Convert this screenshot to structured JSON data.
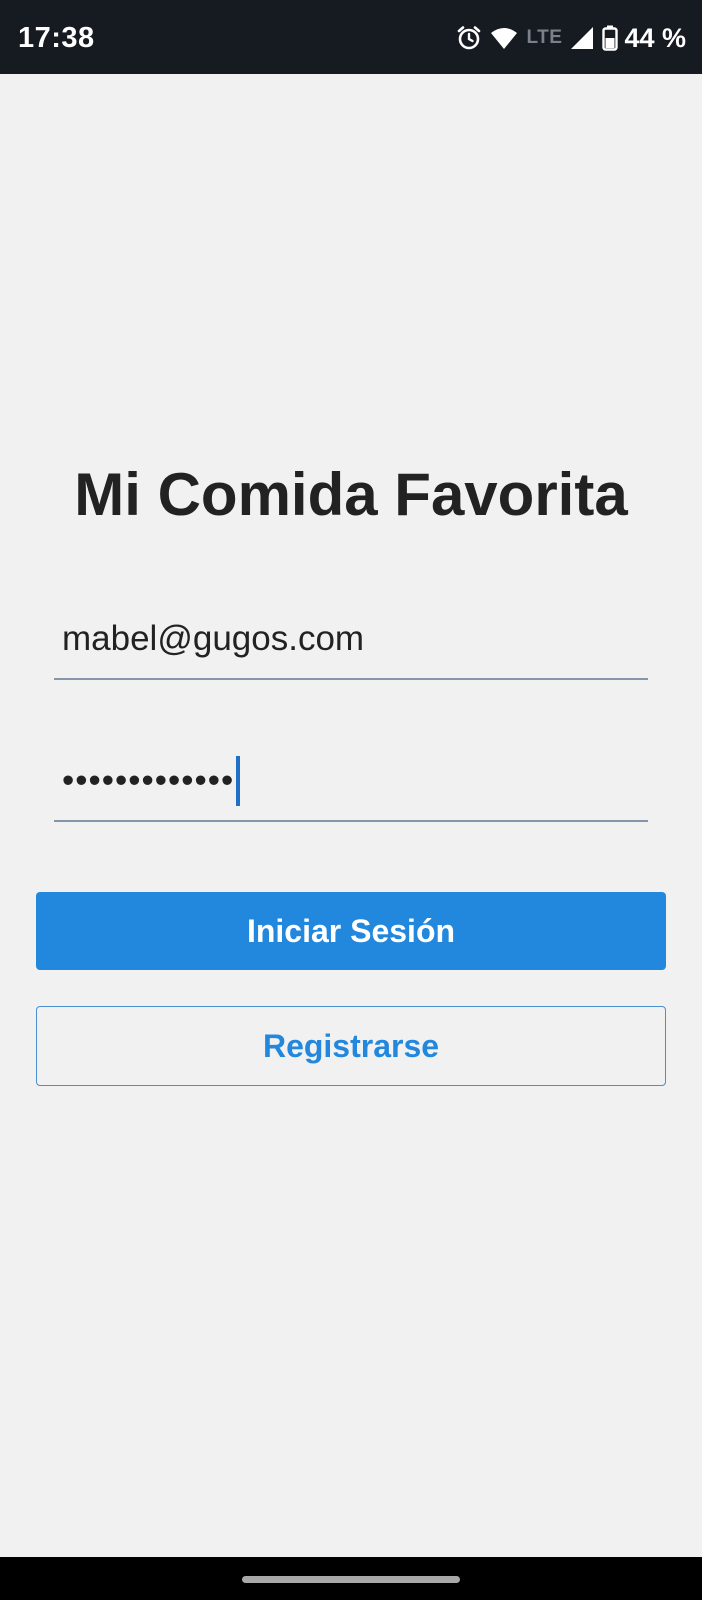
{
  "status_bar": {
    "time": "17:38",
    "network_label": "LTE",
    "battery_percent": "44 %",
    "icons": [
      "alarm-icon",
      "wifi-icon",
      "signal-icon",
      "battery-icon"
    ]
  },
  "app": {
    "title": "Mi Comida Favorita"
  },
  "login_form": {
    "email_value": "mabel@gugos.com",
    "password_masked": "•••••••••••••"
  },
  "buttons": {
    "login_label": "Iniciar Sesión",
    "register_label": "Registrarse"
  },
  "colors": {
    "primary": "#2288dd",
    "background": "#f1f1f1",
    "status_bar": "#161a21",
    "field_underline": "#8595ab",
    "caret": "#2070c8"
  }
}
